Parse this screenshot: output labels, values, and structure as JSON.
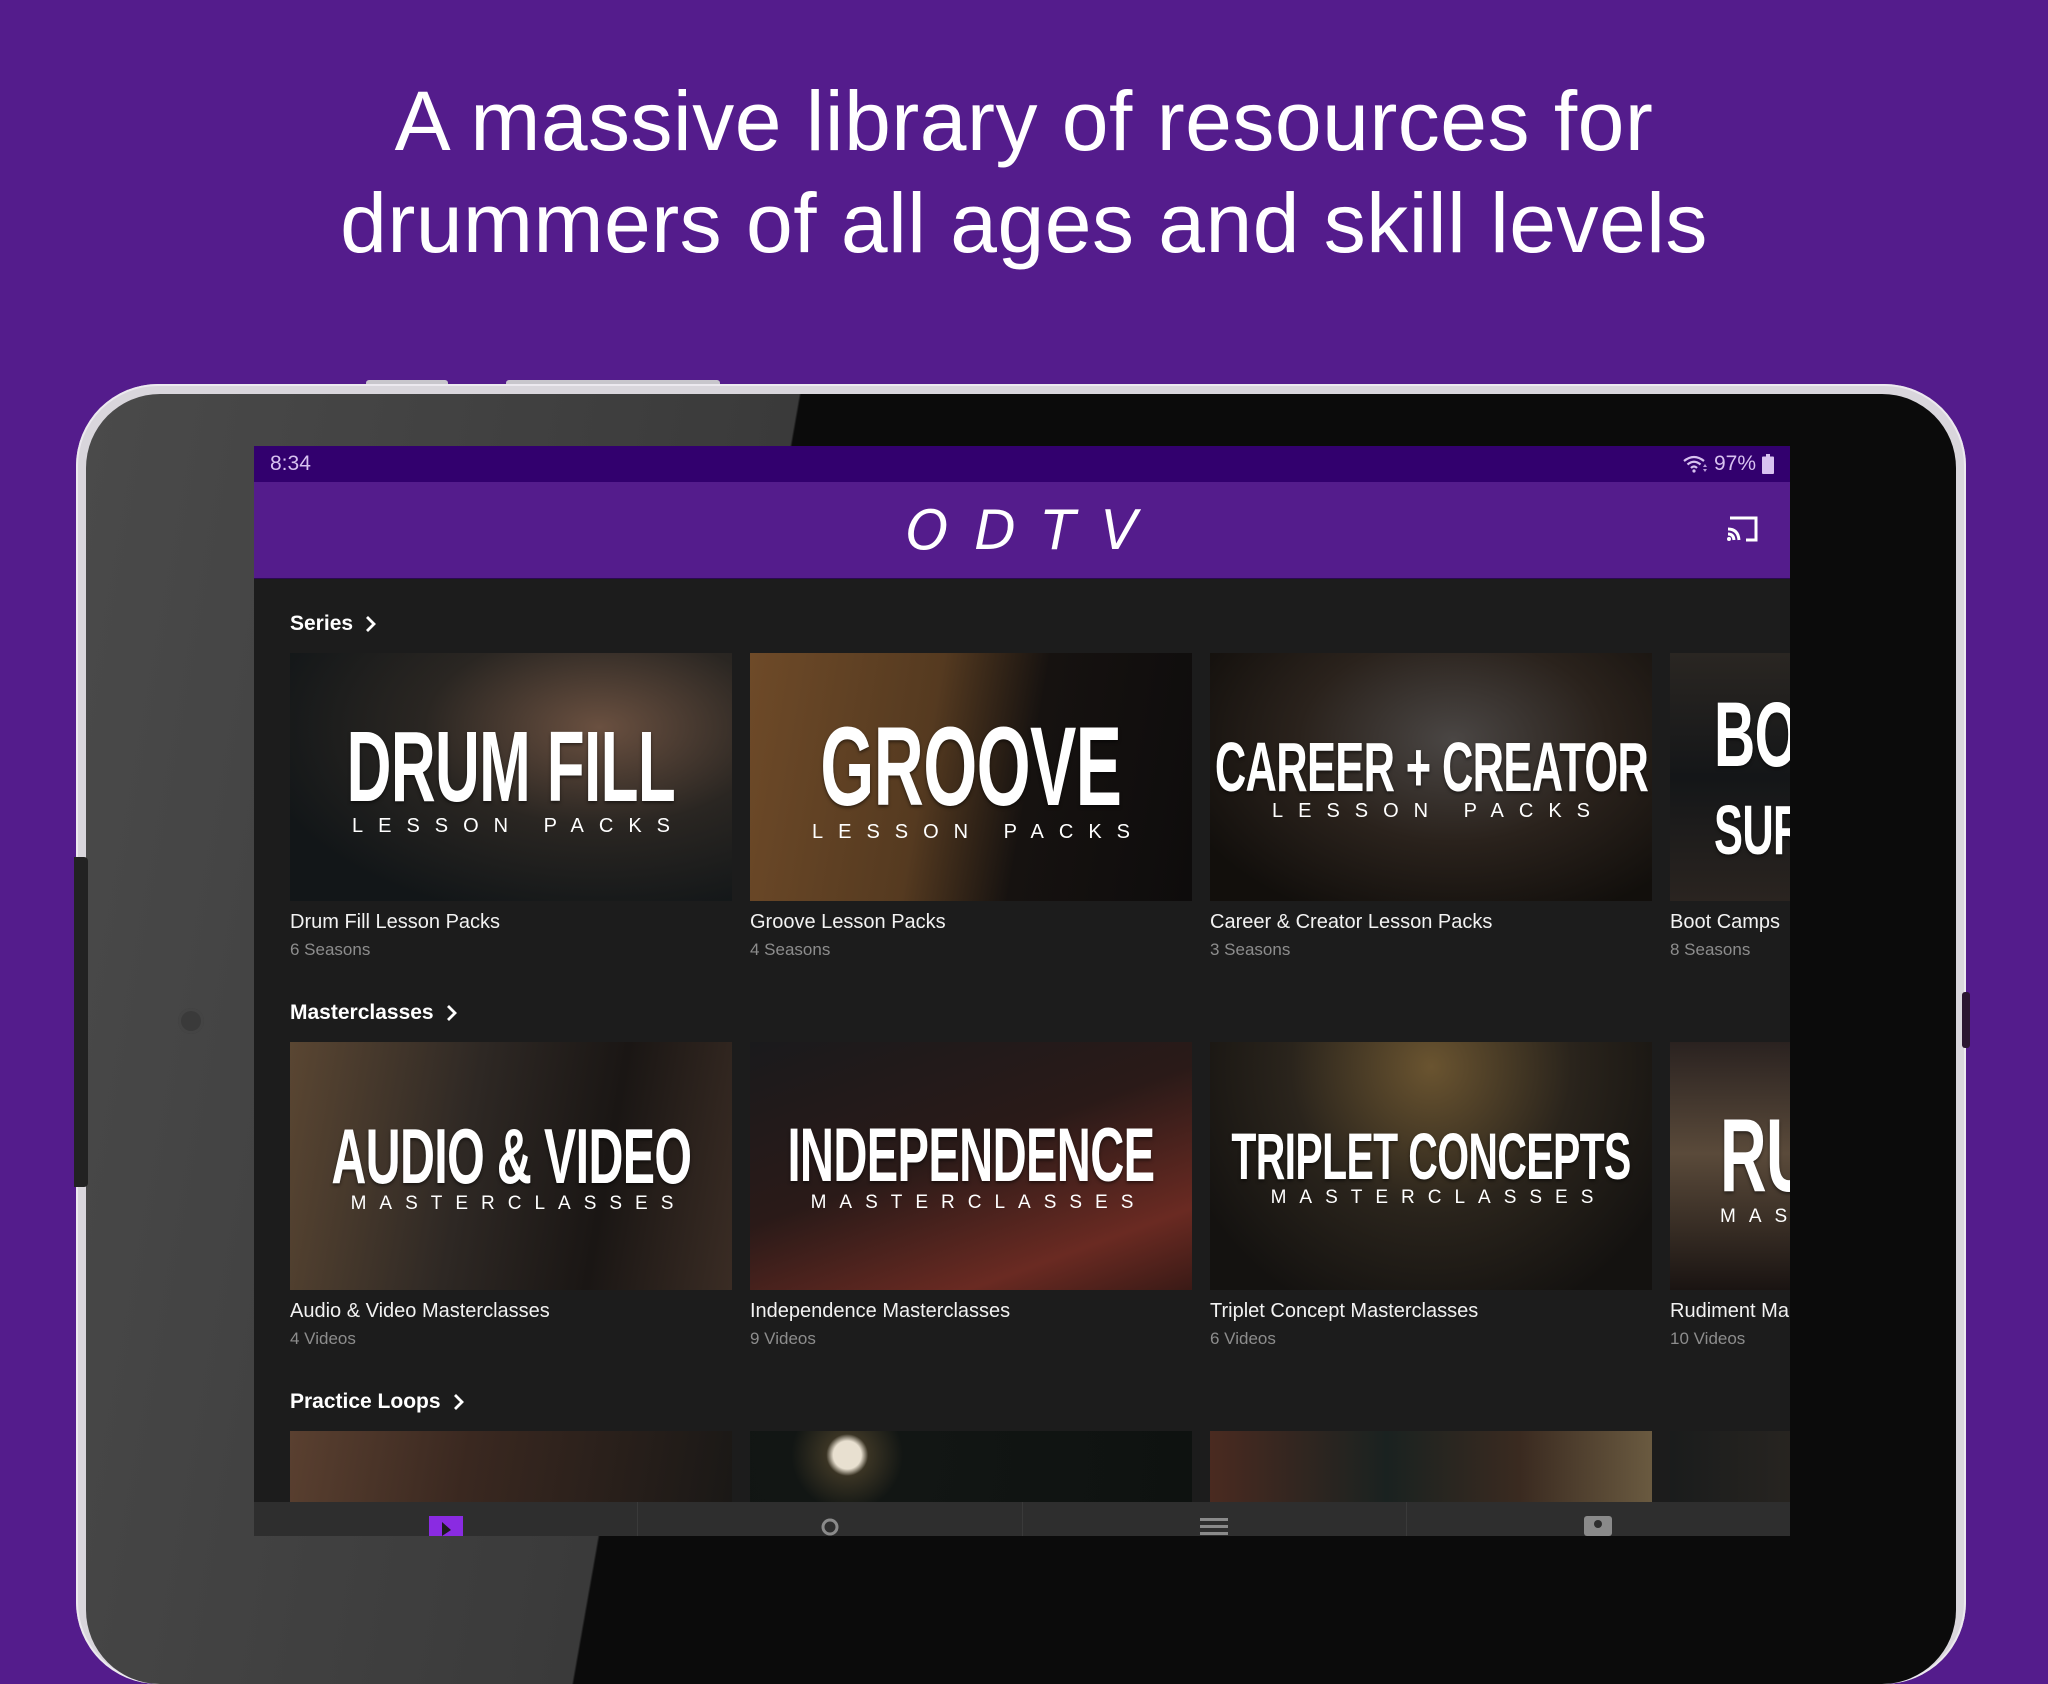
{
  "headline": {
    "line1": "A massive library of resources for",
    "line2": "drummers of all ages and skill levels"
  },
  "colors": {
    "background": "#541c8c",
    "statusbar": "#32006e",
    "appbar": "#541c8c",
    "screen_bg": "#1c1c1c",
    "accent": "#8a2be2"
  },
  "statusbar": {
    "time": "8:34",
    "battery": "97%",
    "icons": [
      "wifi-icon",
      "battery-icon"
    ]
  },
  "appbar": {
    "logo": "ODTV",
    "cast_icon": "cast-icon"
  },
  "sections": [
    {
      "title": "Series",
      "items": [
        {
          "title": "Drum Fill Lesson Packs",
          "subtitle": "6 Seasons",
          "thumb_big": "DRUM FILL",
          "thumb_small": "LESSON PACKS"
        },
        {
          "title": "Groove Lesson Packs",
          "subtitle": "4 Seasons",
          "thumb_big": "GROOVE",
          "thumb_small": "LESSON PACKS"
        },
        {
          "title": "Career & Creator Lesson Packs",
          "subtitle": "3 Seasons",
          "thumb_big": "CAREER + CREATOR",
          "thumb_small": "LESSON PACKS"
        },
        {
          "title": "Boot Camps",
          "subtitle": "8 Seasons",
          "thumb_big": "BO",
          "thumb_small": "SUR"
        }
      ]
    },
    {
      "title": "Masterclasses",
      "items": [
        {
          "title": "Audio & Video Masterclasses",
          "subtitle": "4 Videos",
          "thumb_big": "AUDIO & VIDEO",
          "thumb_small": "MASTERCLASSES"
        },
        {
          "title": "Independence Masterclasses",
          "subtitle": "9 Videos",
          "thumb_big": "INDEPENDENCE",
          "thumb_small": "MASTERCLASSES"
        },
        {
          "title": "Triplet Concept Masterclasses",
          "subtitle": "6 Videos",
          "thumb_big": "TRIPLET CONCEPTS",
          "thumb_small": "MASTERCLASSES"
        },
        {
          "title": "Rudiment Ma",
          "subtitle": "10 Videos",
          "thumb_big": "RU",
          "thumb_small": "MAS"
        }
      ]
    },
    {
      "title": "Practice Loops",
      "items": [
        {},
        {},
        {},
        {}
      ]
    }
  ],
  "bottom_nav": [
    {
      "icon": "play-icon",
      "active": true
    },
    {
      "icon": "search-icon",
      "active": false
    },
    {
      "icon": "menu-icon",
      "active": false
    },
    {
      "icon": "profile-icon",
      "active": false
    }
  ]
}
